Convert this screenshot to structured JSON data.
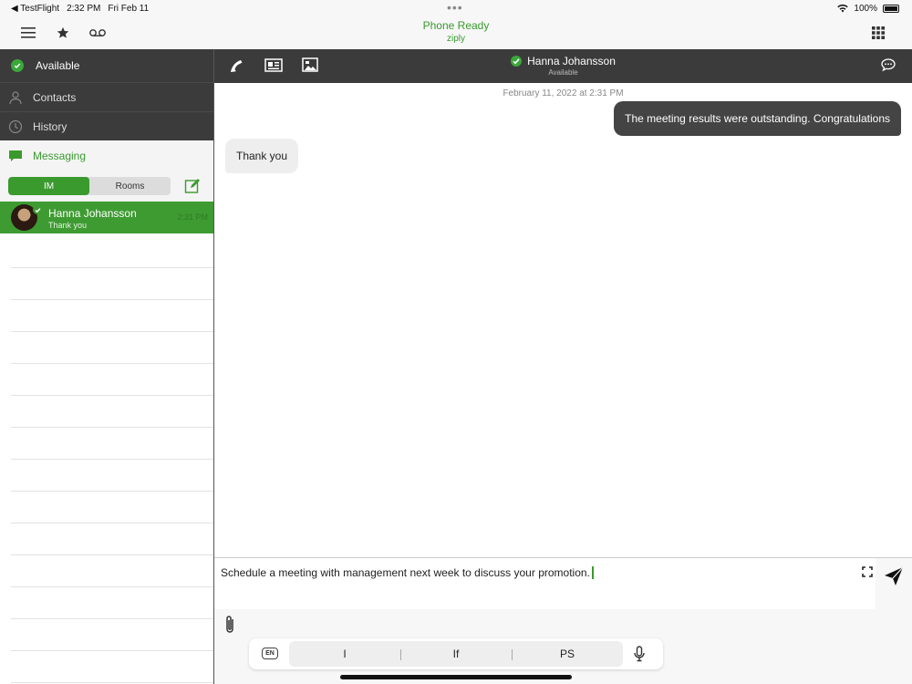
{
  "status_bar": {
    "back_app": "◀ TestFlight",
    "time": "2:32 PM",
    "date": "Fri Feb 11",
    "dots": "•••",
    "battery": "100%"
  },
  "top_bar": {
    "title": "Phone Ready",
    "subtitle": "ziply"
  },
  "left_panel": {
    "presence": "Available",
    "nav": [
      {
        "label": "Contacts"
      },
      {
        "label": "History"
      },
      {
        "label": "Messaging"
      }
    ],
    "segment": {
      "im": "IM",
      "rooms": "Rooms"
    },
    "conversations": [
      {
        "name": "Hanna Johansson",
        "preview": "Thank you",
        "time": "2:31 PM"
      }
    ]
  },
  "chat_header": {
    "name": "Hanna Johansson",
    "status": "Available"
  },
  "chat": {
    "date": "February 11, 2022 at 2:31 PM",
    "messages": [
      {
        "direction": "out",
        "text": "The meeting results were outstanding. Congratulations"
      },
      {
        "direction": "in",
        "text": "Thank you"
      }
    ]
  },
  "composer": {
    "text": "Schedule a meeting with management next week to discuss your promotion.",
    "lang": "EN",
    "suggestions": [
      "I",
      "If",
      "PS"
    ]
  },
  "colors": {
    "accent": "#3a9a2e",
    "dark": "#3b3b3b"
  }
}
